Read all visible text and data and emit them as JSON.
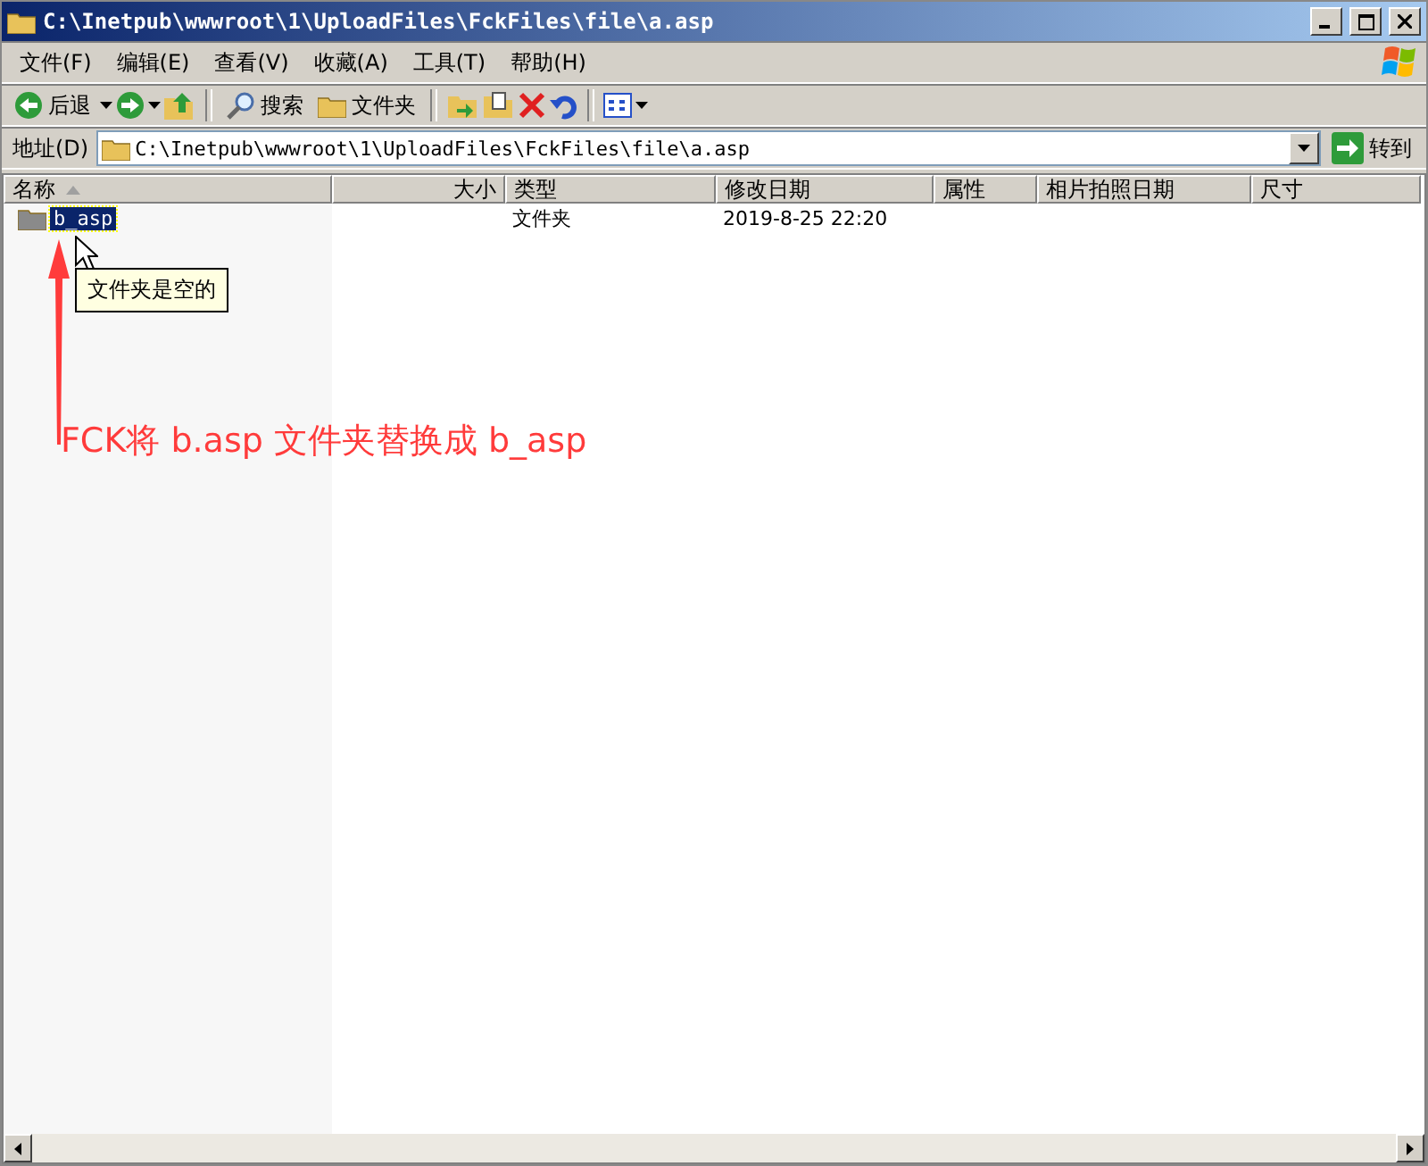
{
  "window": {
    "title": "C:\\Inetpub\\wwwroot\\1\\UploadFiles\\FckFiles\\file\\a.asp"
  },
  "menu": [
    {
      "label": "文件(F)"
    },
    {
      "label": "编辑(E)"
    },
    {
      "label": "查看(V)"
    },
    {
      "label": "收藏(A)"
    },
    {
      "label": "工具(T)"
    },
    {
      "label": "帮助(H)"
    }
  ],
  "toolbar": [
    {
      "kind": "back",
      "label": "后退"
    },
    {
      "kind": "forward"
    },
    {
      "kind": "up"
    },
    {
      "kind": "sep"
    },
    {
      "kind": "search",
      "label": "搜索"
    },
    {
      "kind": "folders",
      "label": "文件夹"
    },
    {
      "kind": "sep"
    },
    {
      "kind": "move"
    },
    {
      "kind": "copy"
    },
    {
      "kind": "delete"
    },
    {
      "kind": "undo"
    },
    {
      "kind": "sep"
    },
    {
      "kind": "views"
    }
  ],
  "address": {
    "label": "地址(D)",
    "value": "C:\\Inetpub\\wwwroot\\1\\UploadFiles\\FckFiles\\file\\a.asp",
    "go": "转到"
  },
  "columns": [
    {
      "label": "名称",
      "sorted": true
    },
    {
      "label": "大小",
      "sorted": false
    },
    {
      "label": "类型",
      "sorted": false
    },
    {
      "label": "修改日期",
      "sorted": false
    },
    {
      "label": "属性",
      "sorted": false
    },
    {
      "label": "相片拍照日期",
      "sorted": false
    },
    {
      "label": "尺寸",
      "sorted": false
    }
  ],
  "rows": [
    {
      "name": "b_asp",
      "type": "文件夹",
      "modified": "2019-8-25 22:20",
      "selected": true
    }
  ],
  "tooltip": "文件夹是空的",
  "annotation": "FCK将 b.asp 文件夹替换成 b_asp"
}
